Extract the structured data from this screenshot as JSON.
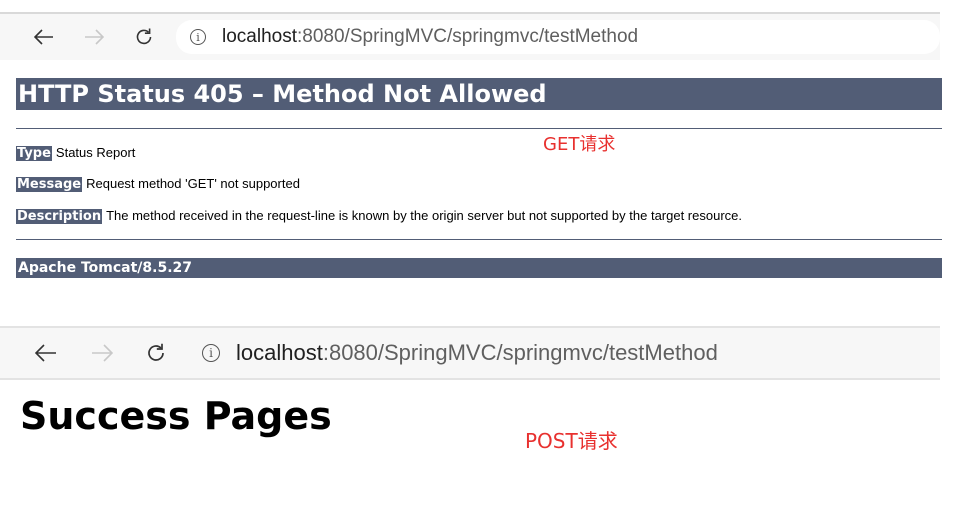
{
  "browser_top": {
    "url_host": "localhost",
    "url_rest": ":8080/SpringMVC/springmvc/testMethod"
  },
  "error_page": {
    "title": "HTTP Status 405 – Method Not Allowed",
    "type_label": "Type",
    "type_value": "Status Report",
    "message_label": "Message",
    "message_value": "Request method 'GET' not supported",
    "description_label": "Description",
    "description_value": "The method received in the request-line is known by the origin server but not supported by the target resource.",
    "footer": "Apache Tomcat/8.5.27"
  },
  "annotations": {
    "get": "GET请求",
    "post": "POST请求",
    "color": "#e8312f"
  },
  "browser_bottom": {
    "url_host": "localhost",
    "url_rest": ":8080/SpringMVC/springmvc/testMethod"
  },
  "success_page": {
    "heading": "Success Pages"
  },
  "icons": {
    "back": "back-arrow-icon",
    "forward": "forward-arrow-icon",
    "reload": "reload-icon",
    "info": "info-icon"
  },
  "colors": {
    "tomcat_header": "#525d76"
  }
}
